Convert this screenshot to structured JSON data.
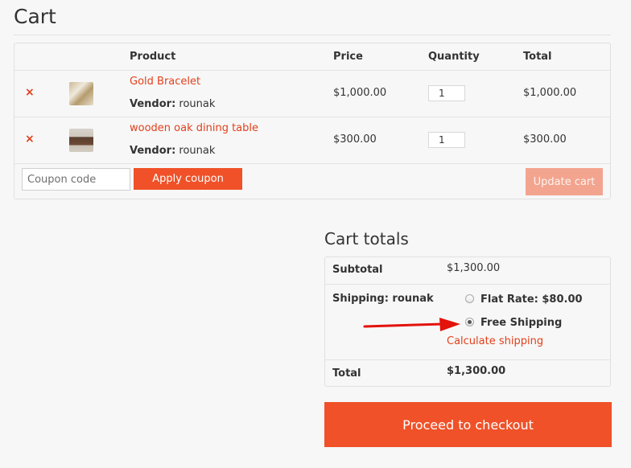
{
  "page": {
    "title": "Cart"
  },
  "cart": {
    "headers": {
      "product": "Product",
      "price": "Price",
      "quantity": "Quantity",
      "total": "Total"
    },
    "items": [
      {
        "remove": "×",
        "name": "Gold Bracelet",
        "vendor_label": "Vendor:",
        "vendor": "rounak",
        "price": "$1,000.00",
        "quantity": "1",
        "total": "$1,000.00",
        "thumb": "bracelet-thumbnail"
      },
      {
        "remove": "×",
        "name": "wooden oak dining table",
        "vendor_label": "Vendor:",
        "vendor": "rounak",
        "price": "$300.00",
        "quantity": "1",
        "total": "$300.00",
        "thumb": "dining-table-thumbnail"
      }
    ],
    "coupon_placeholder": "Coupon code",
    "apply_coupon": "Apply coupon",
    "update_cart": "Update cart"
  },
  "totals": {
    "title": "Cart totals",
    "subtotal_label": "Subtotal",
    "subtotal": "$1,300.00",
    "shipping_label": "Shipping: rounak",
    "options": [
      {
        "label": "Flat Rate: $80.00",
        "selected": false
      },
      {
        "label": "Free Shipping",
        "selected": true
      }
    ],
    "calculate_shipping": "Calculate shipping",
    "total_label": "Total",
    "total": "$1,300.00"
  },
  "checkout": {
    "label": "Proceed to checkout"
  },
  "colors": {
    "accent": "#f05128",
    "link": "#e2401c",
    "annotation_arrow": "#e3120b"
  }
}
